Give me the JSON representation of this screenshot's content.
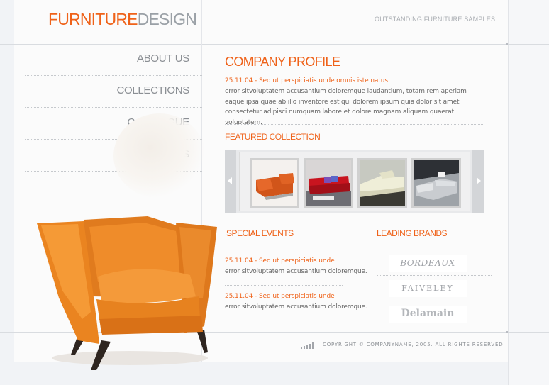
{
  "header": {
    "logo_part1": "FURNITURE",
    "logo_part2": "DESIGN",
    "tagline": "OUTSTANDING FURNITURE SAMPLES"
  },
  "nav": {
    "items": [
      {
        "label": "ABOUT US"
      },
      {
        "label": "COLLECTIONS"
      },
      {
        "label": "CATALOGUE"
      },
      {
        "label": "CONTACTS"
      }
    ]
  },
  "profile": {
    "title": "COMPANY PROFILE",
    "date_line": "25.11.04 - Sed ut perspiciatis unde omnis iste natus",
    "body": "error sitvoluptatem accusantium doloremque laudantium, totam rem aperiam eaque ipsa quae ab illo inventore est qui dolorem ipsum quia dolor sit amet consectetur adipisci numquam labore et dolore magnam aliquam quaerat voluptatem."
  },
  "featured": {
    "title": "FEATURED COLLECTION"
  },
  "events": {
    "title": "SPECIAL EVENTS",
    "items": [
      {
        "date_line": "25.11.04 - Sed ut perspiciatis unde",
        "text": "error sitvoluptatem accusantium doloremque."
      },
      {
        "date_line": "25.11.04 - Sed ut perspiciatis unde",
        "text": "error sitvoluptatem accusantium doloremque."
      }
    ]
  },
  "brands": {
    "title": "LEADING BRANDS",
    "items": [
      "BORDEAUX",
      "FAIVELEY",
      "Delamain"
    ]
  },
  "footer": {
    "copyright": "COPYRIGHT © COMPANYNAME, 2005. ALL RIGHTS RESERVED"
  },
  "colors": {
    "accent": "#ef6219",
    "logo_grey": "#9aa0a6",
    "nav_text": "#8b8f94"
  }
}
